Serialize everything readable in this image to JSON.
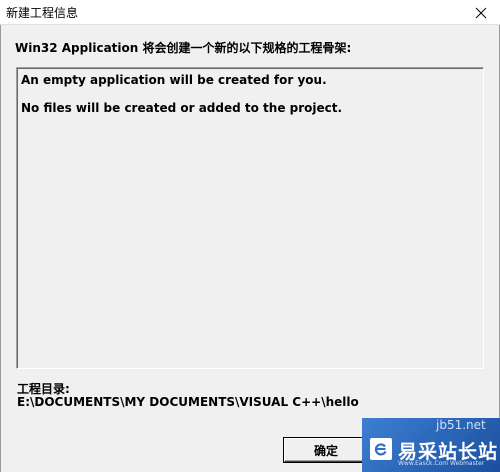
{
  "window": {
    "title": "新建工程信息",
    "close_icon": "close-icon"
  },
  "dialog": {
    "heading": "Win32 Application 将会创建一个新的以下规格的工程骨架:",
    "info_lines": [
      "An empty application will be created for you.",
      "No files will be created or added to the project."
    ],
    "directory_label": "工程目录:",
    "directory_path": "E:\\DOCUMENTS\\MY DOCUMENTS\\VISUAL C++\\hello",
    "ok_label": "确定"
  },
  "watermark": {
    "site": "jb51.net",
    "brand": "易采站长站",
    "tagline": "Www.Easck.Com  Webmaster",
    "logo_icon": "e-logo-icon",
    "colors": {
      "bg": "#2f6fc4",
      "text": "#ffffff"
    }
  }
}
